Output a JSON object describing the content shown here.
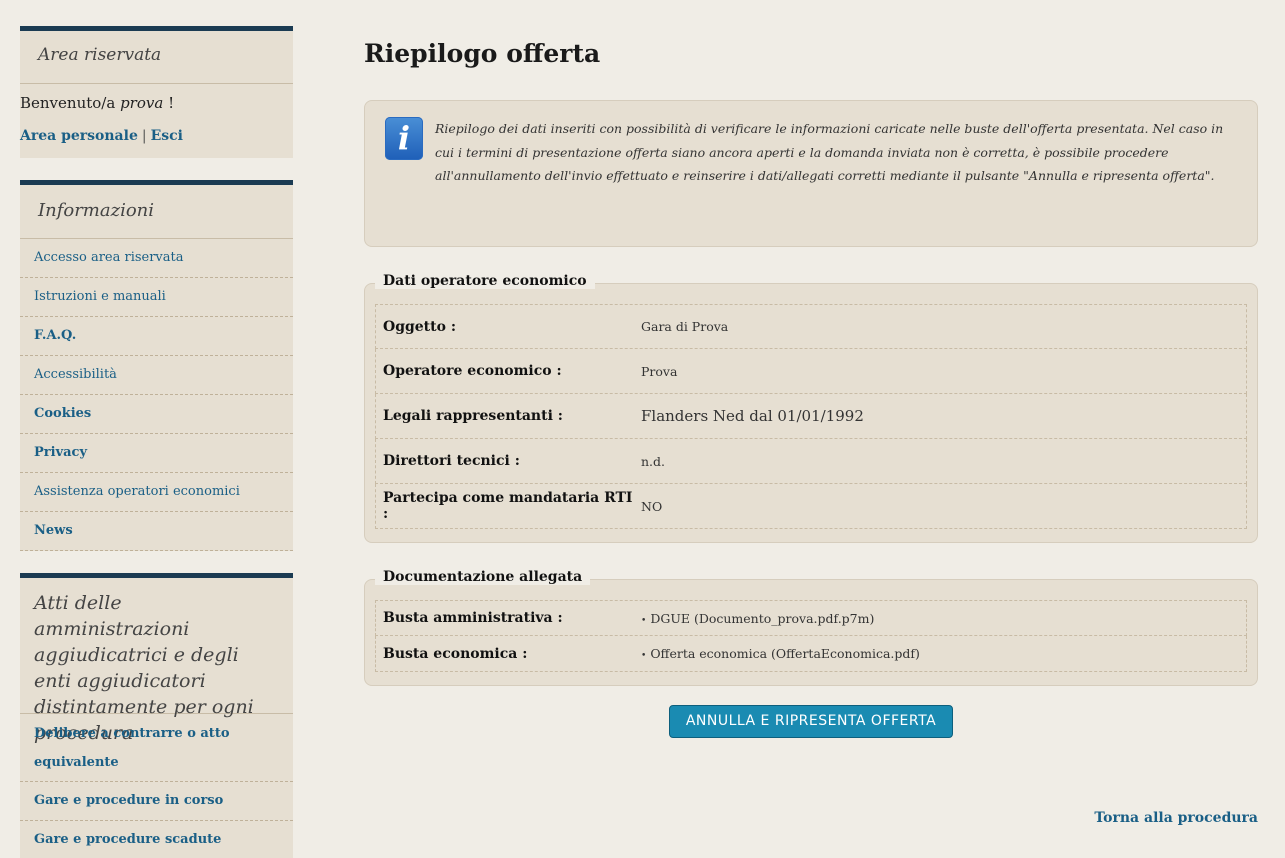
{
  "sidebar": {
    "area_title": "Area riservata",
    "welcome_prefix": "Benvenuto/a ",
    "welcome_user": "prova",
    "welcome_suffix": " !",
    "area_personale": "Area personale",
    "separator": "|",
    "esci": "Esci",
    "info_title": "Informazioni",
    "info_items": [
      "Accesso area riservata",
      "Istruzioni e manuali",
      "F.A.Q.",
      "Accessibilità",
      "Cookies",
      "Privacy",
      "Assistenza operatori economici",
      "News"
    ],
    "atti_title": "Atti delle amministrazioni aggiudicatrici e degli enti aggiudicatori distintamente per ogni procedura",
    "atti_items": [
      "Delibere a contrarre o atto equivalente",
      "Gare e procedure in corso",
      "Gare e procedure scadute"
    ]
  },
  "main": {
    "title": "Riepilogo offerta",
    "info_icon": "info-icon",
    "info_text": "Riepilogo dei dati inseriti con possibilità di verificare le informazioni caricate nelle buste dell'offerta presentata. Nel caso in cui i termini di presentazione offerta siano ancora aperti e la domanda inviata non è corretta, è possibile procedere all'annullamento dell'invio effettuato e reinserire i dati/allegati corretti mediante il pulsante \"Annulla e ripresenta offerta\".",
    "operatore_legend": "Dati operatore economico",
    "operatore_rows": [
      {
        "label": "Oggetto :",
        "value": "Gara di Prova"
      },
      {
        "label": "Operatore economico :",
        "value": "Prova"
      },
      {
        "label": "Legali rappresentanti :",
        "value": "Flanders Ned dal 01/01/1992"
      },
      {
        "label": "Direttori tecnici :",
        "value": "n.d."
      },
      {
        "label": "Partecipa come mandataria RTI :",
        "value": "NO"
      }
    ],
    "documenti_legend": "Documentazione allegata",
    "documenti_rows": [
      {
        "label": "Busta amministrativa :",
        "value": "DGUE  (Documento_prova.pdf.p7m)"
      },
      {
        "label": "Busta economica :",
        "value": "Offerta economica  (OffertaEconomica.pdf)"
      }
    ],
    "button_label": "ANNULLA E RIPRESENTA OFFERTA",
    "back_link": "Torna alla procedura"
  },
  "colors": {
    "background": "#f0ede6",
    "panel": "#e6dfd2",
    "sidebar_accent": "#1b3b52",
    "link": "#1a5f86",
    "button": "#1a8bb2"
  }
}
